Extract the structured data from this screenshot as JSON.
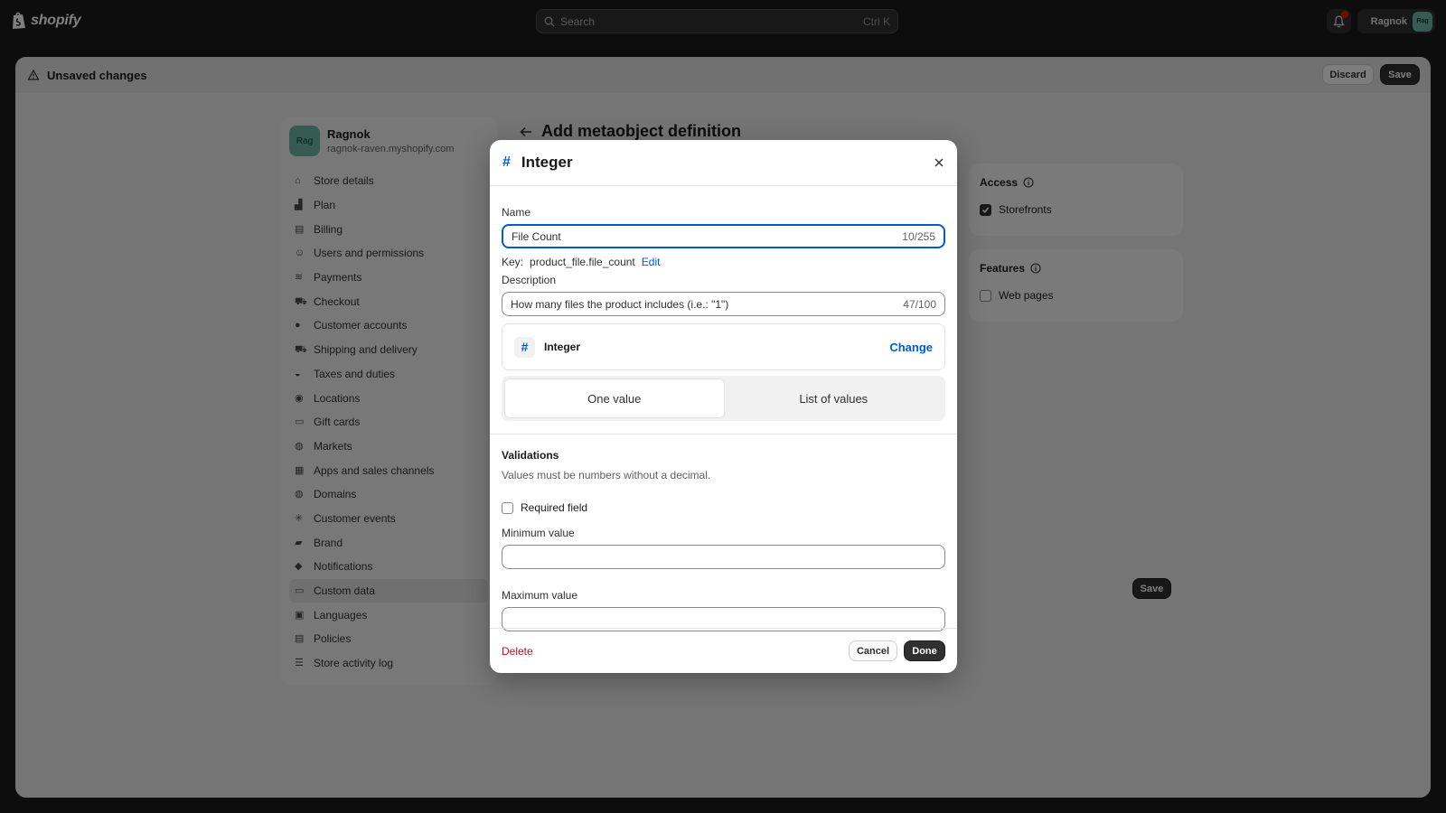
{
  "topbar": {
    "logo_text": "shopify",
    "search_placeholder": "Search",
    "search_shortcut": "Ctrl K",
    "notification_count": "1",
    "user_name": "Ragnok",
    "user_initials": "Rag"
  },
  "unsaved_bar": {
    "message": "Unsaved changes",
    "discard_label": "Discard",
    "save_label": "Save"
  },
  "sidebar": {
    "store_name": "Ragnok",
    "store_domain": "ragnok-raven.myshopify.com",
    "store_initials": "Rag",
    "items": [
      {
        "label": "Store details",
        "icon": "store-icon"
      },
      {
        "label": "Plan",
        "icon": "plan-icon"
      },
      {
        "label": "Billing",
        "icon": "billing-icon"
      },
      {
        "label": "Users and permissions",
        "icon": "users-icon"
      },
      {
        "label": "Payments",
        "icon": "payments-icon"
      },
      {
        "label": "Checkout",
        "icon": "cart-icon"
      },
      {
        "label": "Customer accounts",
        "icon": "person-icon"
      },
      {
        "label": "Shipping and delivery",
        "icon": "truck-icon"
      },
      {
        "label": "Taxes and duties",
        "icon": "tax-icon"
      },
      {
        "label": "Locations",
        "icon": "location-icon"
      },
      {
        "label": "Gift cards",
        "icon": "gift-card-icon"
      },
      {
        "label": "Markets",
        "icon": "globe-icon"
      },
      {
        "label": "Apps and sales channels",
        "icon": "apps-icon"
      },
      {
        "label": "Domains",
        "icon": "domain-icon"
      },
      {
        "label": "Customer events",
        "icon": "events-icon"
      },
      {
        "label": "Brand",
        "icon": "brand-icon"
      },
      {
        "label": "Notifications",
        "icon": "bell-icon"
      },
      {
        "label": "Custom data",
        "icon": "data-icon"
      },
      {
        "label": "Languages",
        "icon": "language-icon"
      },
      {
        "label": "Policies",
        "icon": "policy-icon"
      },
      {
        "label": "Store activity log",
        "icon": "list-icon"
      }
    ],
    "active_item": "Custom data"
  },
  "page": {
    "title": "Add metaobject definition",
    "access_title": "Access",
    "access_option": "Storefronts",
    "access_checked": true,
    "features_title": "Features",
    "features_option": "Web pages",
    "features_checked": false,
    "save_label": "Save"
  },
  "modal": {
    "type_icon": "#",
    "title": "Integer",
    "name_label": "Name",
    "name_value": "File Count",
    "name_count": "10/255",
    "key_label": "Key:",
    "key_value": "product_file.file_count",
    "key_edit": "Edit",
    "description_label": "Description",
    "description_value": "How many files the product includes (i.e.: \"1\")",
    "description_count": "47/100",
    "type_name": "Integer",
    "change_label": "Change",
    "value_options": [
      "One value",
      "List of values"
    ],
    "selected_option": "One value",
    "validations_title": "Validations",
    "validations_desc": "Values must be numbers without a decimal.",
    "required_label": "Required field",
    "required_checked": false,
    "min_label": "Minimum value",
    "min_value": "",
    "max_label": "Maximum value",
    "max_value": "",
    "delete_label": "Delete",
    "cancel_label": "Cancel",
    "done_label": "Done"
  },
  "colors": {
    "accent": "#005bd3",
    "danger": "#c70a24",
    "avatar": "#6bb7a7"
  }
}
